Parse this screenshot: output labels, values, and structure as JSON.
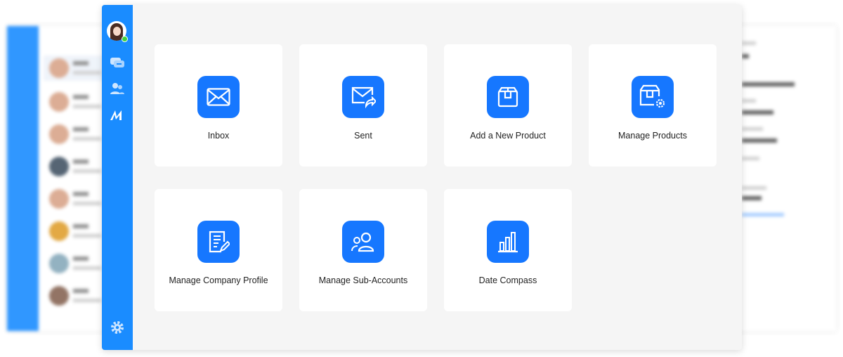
{
  "main_sidebar": {
    "items": [
      {
        "name": "chat",
        "icon": "chat-bubbles-icon"
      },
      {
        "name": "contacts",
        "icon": "contacts-icon"
      },
      {
        "name": "brand",
        "icon": "m-logo-icon"
      }
    ],
    "settings_icon": "gear-icon",
    "status": "online"
  },
  "cards": [
    {
      "label": "Inbox",
      "icon": "envelope-icon"
    },
    {
      "label": "Sent",
      "icon": "envelope-send-icon"
    },
    {
      "label": "Add a New Product",
      "icon": "box-icon"
    },
    {
      "label": "Manage Products",
      "icon": "box-gear-icon"
    },
    {
      "label": "Manage Company Profile",
      "icon": "document-edit-icon"
    },
    {
      "label": "Manage Sub-Accounts",
      "icon": "users-icon"
    },
    {
      "label": "Date Compass",
      "icon": "bar-chart-icon"
    }
  ],
  "colors": {
    "sidebar": "#1a8cff",
    "icon_tile": "#1677ff",
    "content_bg": "#f5f5f5",
    "online": "#3fd33f"
  }
}
